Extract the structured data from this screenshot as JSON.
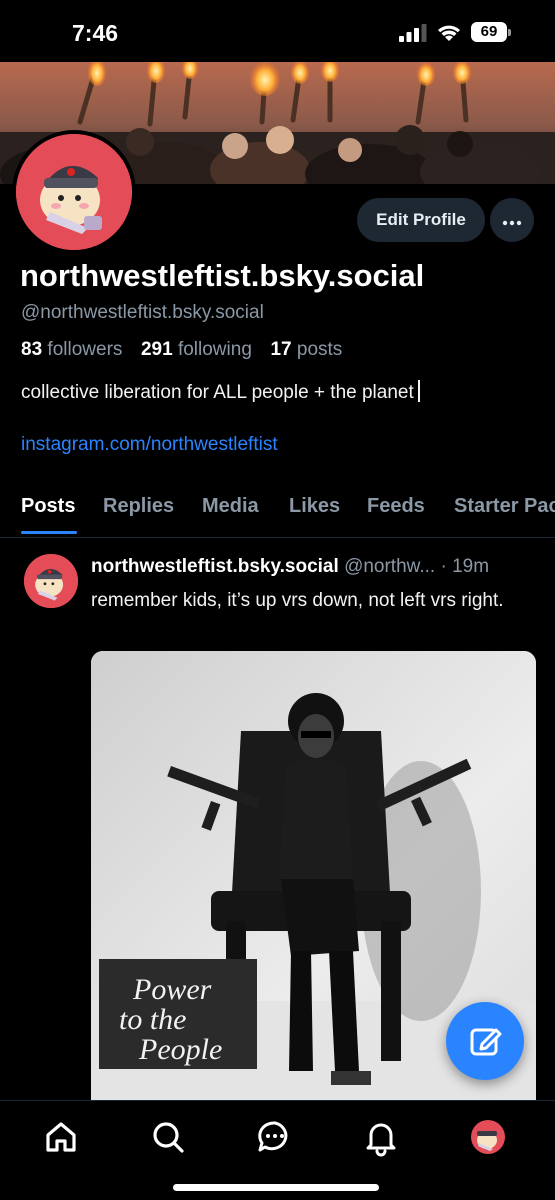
{
  "status_bar": {
    "time": "7:46",
    "battery": "69"
  },
  "profile": {
    "display_name": "northwestleftist.bsky.social",
    "handle": "@northwestleftist.bsky.social",
    "followers_count": "83",
    "followers_label": "followers",
    "following_count": "291",
    "following_label": "following",
    "posts_count": "17",
    "posts_label": "posts",
    "bio": "collective liberation for ALL people + the planet",
    "link": "instagram.com/northwestleftist",
    "edit_label": "Edit Profile",
    "more_label": "•••"
  },
  "tabs": [
    {
      "label": "Posts",
      "active": true
    },
    {
      "label": "Replies"
    },
    {
      "label": "Media"
    },
    {
      "label": "Likes"
    },
    {
      "label": "Feeds"
    },
    {
      "label": "Starter Packs"
    }
  ],
  "post": {
    "author_name": "northwestleftist.bsky.social",
    "author_handle": "@northw...",
    "separator": " · ",
    "time": "19m",
    "text": "remember kids, it’s up vrs down, not left vrs right.",
    "image_sign_lines": [
      "Power",
      "to the",
      "People"
    ]
  },
  "bottom_nav": [
    {
      "name": "home-icon"
    },
    {
      "name": "search-icon"
    },
    {
      "name": "chat-icon"
    },
    {
      "name": "bell-icon"
    },
    {
      "name": "profile-avatar"
    }
  ],
  "colors": {
    "background": "#000000",
    "accent": "#2a84ff",
    "muted_text": "#8b98a5",
    "button_bg": "#1e2833",
    "avatar_bg": "#e44d57"
  }
}
